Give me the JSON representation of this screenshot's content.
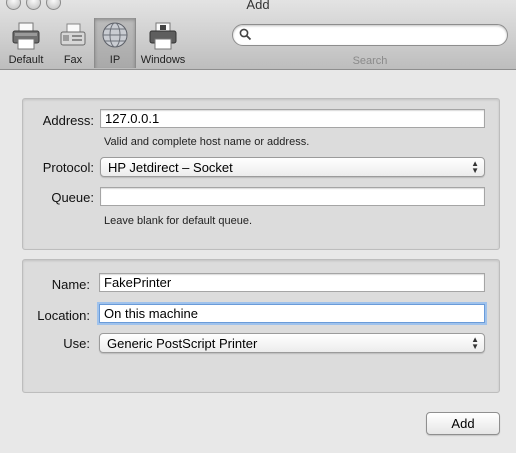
{
  "window": {
    "title": "Add"
  },
  "toolbar": {
    "items": [
      {
        "label": "Default",
        "icon": "printer-icon"
      },
      {
        "label": "Fax",
        "icon": "fax-icon"
      },
      {
        "label": "IP",
        "icon": "globe-icon",
        "selected": true
      },
      {
        "label": "Windows",
        "icon": "windows-printer-icon"
      }
    ],
    "search": {
      "label": "Search",
      "placeholder": "",
      "value": ""
    }
  },
  "connection": {
    "address_label": "Address:",
    "address_value": "127.0.0.1",
    "address_hint": "Valid and complete host name or address.",
    "protocol_label": "Protocol:",
    "protocol_value": "HP Jetdirect – Socket",
    "queue_label": "Queue:",
    "queue_value": "",
    "queue_hint": "Leave blank for default queue."
  },
  "printer": {
    "name_label": "Name:",
    "name_value": "FakePrinter",
    "location_label": "Location:",
    "location_value": "On this machine",
    "use_label": "Use:",
    "use_value": "Generic PostScript Printer"
  },
  "footer": {
    "add_label": "Add"
  },
  "colors": {
    "focus_ring": "#9fc2ec",
    "window_bg": "#e8e8e8",
    "panel_bg": "#dcdcdc"
  }
}
